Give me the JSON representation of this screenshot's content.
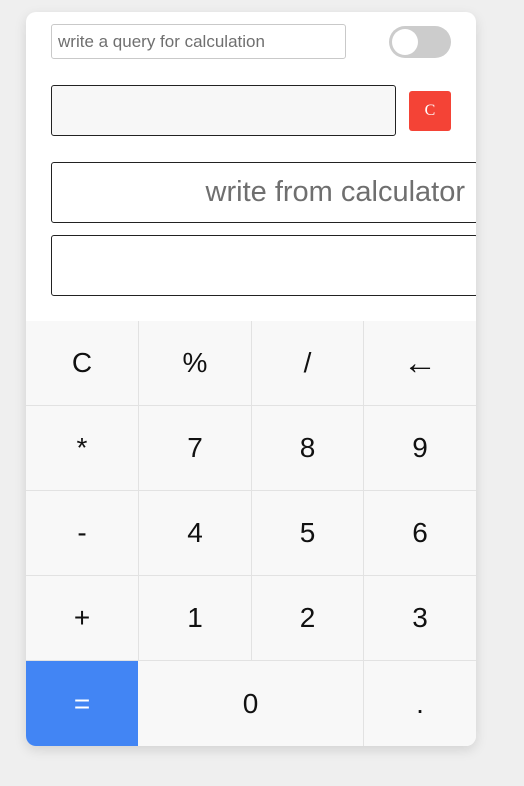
{
  "query": {
    "placeholder": "write a query for calculation",
    "value": "",
    "result": ""
  },
  "toggle": {
    "state": "off"
  },
  "clear_small": {
    "label": "C",
    "color": "#f44336"
  },
  "calculator": {
    "display_placeholder": "write from calculator",
    "display_value": "",
    "output": ""
  },
  "keys": [
    {
      "label": "C"
    },
    {
      "label": "%"
    },
    {
      "label": "/"
    },
    {
      "label": "←"
    },
    {
      "label": "*"
    },
    {
      "label": "7"
    },
    {
      "label": "8"
    },
    {
      "label": "9"
    },
    {
      "label": "-"
    },
    {
      "label": "4"
    },
    {
      "label": "5"
    },
    {
      "label": "6"
    },
    {
      "label": "+"
    },
    {
      "label": "1"
    },
    {
      "label": "2"
    },
    {
      "label": "3"
    },
    {
      "label": "="
    },
    {
      "label": "0"
    },
    {
      "label": "."
    }
  ],
  "colors": {
    "equals_key": "#4285f4",
    "key_background": "#f8f8f8"
  }
}
